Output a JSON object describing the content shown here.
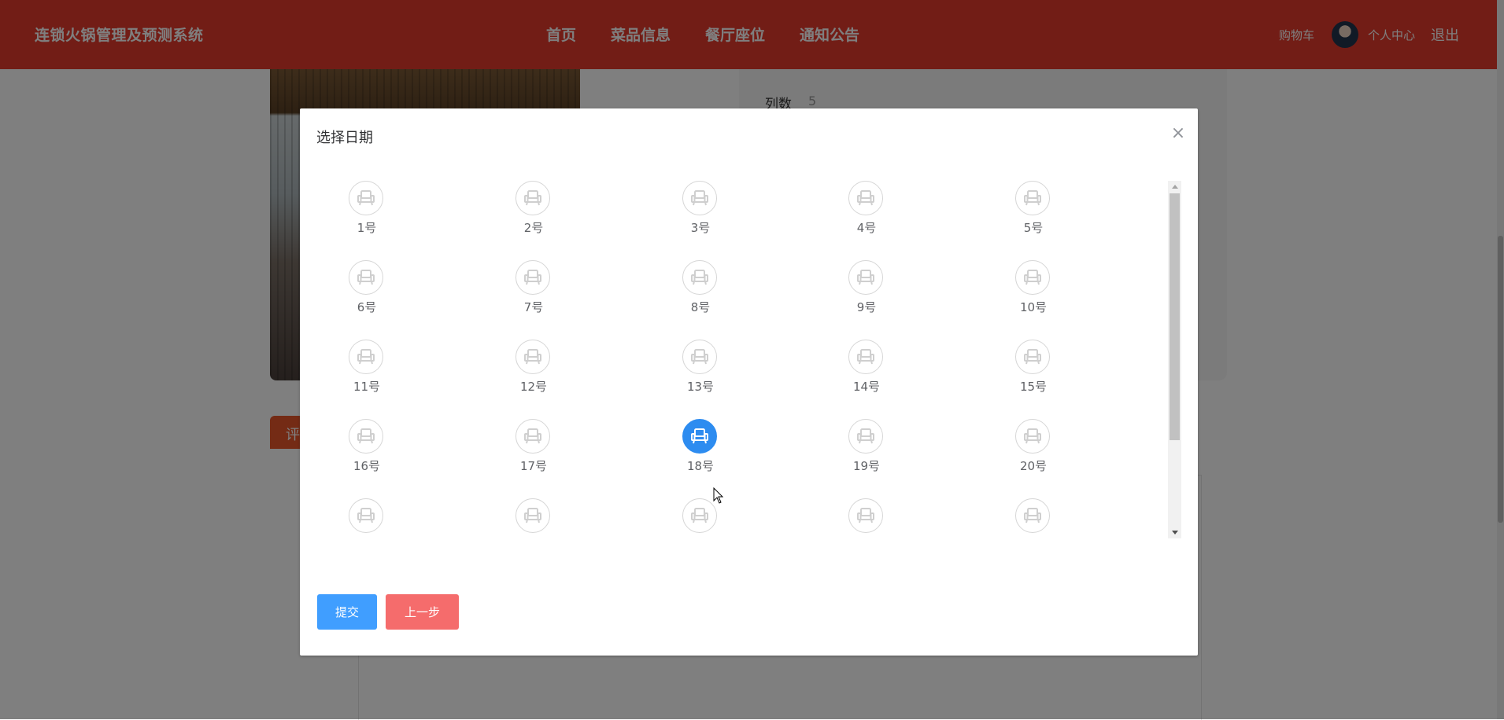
{
  "header": {
    "brand": "连锁火锅管理及预测系统",
    "nav": [
      "首页",
      "菜品信息",
      "餐厅座位",
      "通知公告"
    ],
    "cart": "购物车",
    "personal_center": "个人中心",
    "logout": "退出"
  },
  "page": {
    "info_label": "列数",
    "info_value": "5",
    "tab_label": "评"
  },
  "dialog": {
    "title": "选择日期",
    "close_icon": "close-icon",
    "seat_icon": "armchair-icon",
    "selected_seat": "18号",
    "seats": [
      "1号",
      "2号",
      "3号",
      "4号",
      "5号",
      "6号",
      "7号",
      "8号",
      "9号",
      "10号",
      "11号",
      "12号",
      "13号",
      "14号",
      "15号",
      "16号",
      "17号",
      "18号",
      "19号",
      "20号",
      "",
      "",
      "",
      "",
      ""
    ],
    "submit_label": "提交",
    "prev_label": "上一步"
  },
  "colors": {
    "header": "#e53b2d",
    "seat_selected": "#2d8cf0",
    "submit": "#409eff",
    "prev": "#f56c6c"
  }
}
